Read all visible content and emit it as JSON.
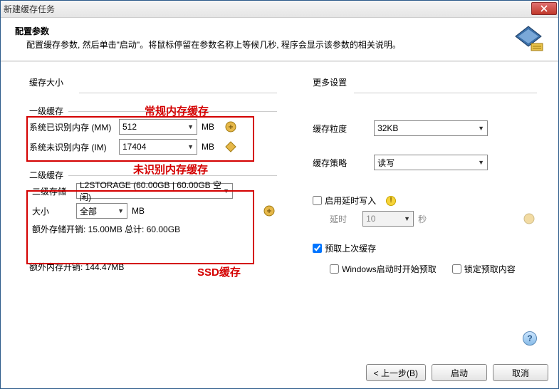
{
  "window": {
    "title": "新建缓存任务"
  },
  "header": {
    "title": "配置参数",
    "desc": "配置缓存参数, 然后单击\"启动\"。将鼠标停留在参数名称上等候几秒, 程序会显示该参数的相关说明。"
  },
  "left": {
    "group": "缓存大小",
    "l1": {
      "label": "一级缓存",
      "mm_label": "系统已识别内存 (MM)",
      "mm_value": "512",
      "mm_unit": "MB",
      "im_label": "系统未识别内存 (IM)",
      "im_value": "17404",
      "im_unit": "MB"
    },
    "l2": {
      "label": "二级缓存",
      "storage_label": "二级存储",
      "storage_value": "L2STORAGE (60.00GB | 60.00GB 空闲)",
      "size_label": "大小",
      "size_value": "全部",
      "size_unit": "MB",
      "overhead": "额外存储开销: 15.00MB  总计: 60.00GB"
    },
    "annotations": {
      "a1": "常规内存缓存",
      "a2": "未识别内存缓存",
      "a3": "SSD缓存"
    },
    "extra_mem": "额外内存开销: 144.47MB"
  },
  "right": {
    "group": "更多设置",
    "gran_label": "缓存粒度",
    "gran_value": "32KB",
    "policy_label": "缓存策略",
    "policy_value": "读写",
    "defer_label": "启用延时写入",
    "delay_label": "延时",
    "delay_value": "10",
    "delay_unit": "秒",
    "preload_label": "预取上次缓存",
    "preload_on_boot": "Windows启动时开始预取",
    "lock_preload": "锁定预取内容"
  },
  "footer": {
    "back": "< 上一步(B)",
    "start": "启动",
    "cancel": "取消"
  }
}
